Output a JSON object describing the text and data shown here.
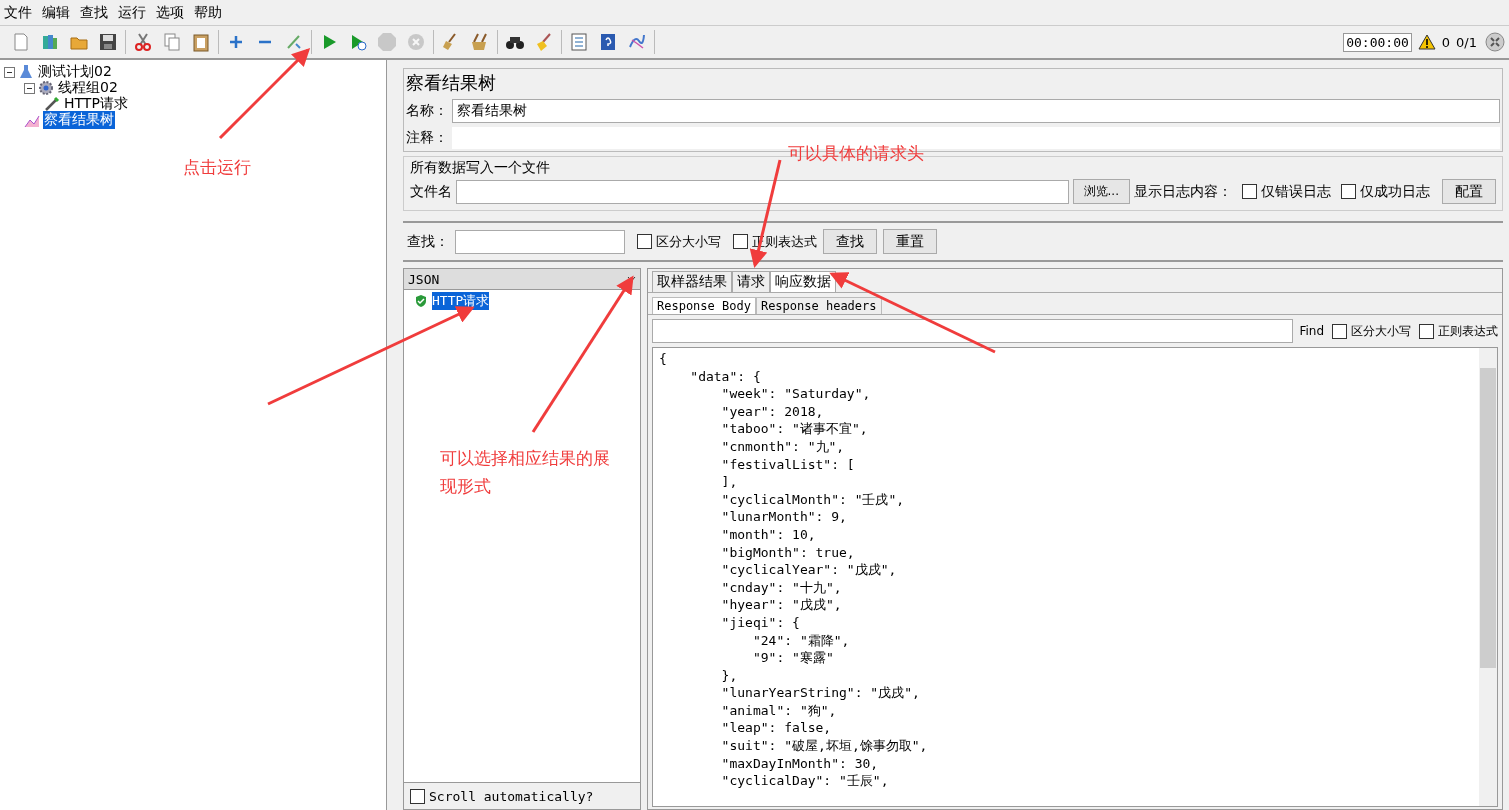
{
  "menu": [
    "文件",
    "编辑",
    "查找",
    "运行",
    "选项",
    "帮助"
  ],
  "toolbar": {
    "groups": [
      [
        {
          "kind": "new",
          "disabled": false
        },
        {
          "kind": "templates",
          "disabled": false
        },
        {
          "kind": "open",
          "disabled": false
        },
        {
          "kind": "save",
          "disabled": false
        }
      ],
      [
        {
          "kind": "cut",
          "disabled": false
        },
        {
          "kind": "copy",
          "disabled": false
        },
        {
          "kind": "paste",
          "disabled": false
        }
      ],
      [
        {
          "kind": "expand",
          "disabled": false
        },
        {
          "kind": "collapse",
          "disabled": false
        },
        {
          "kind": "toggle",
          "disabled": false
        }
      ],
      [
        {
          "kind": "start",
          "disabled": false
        },
        {
          "kind": "start-no-pause",
          "disabled": false
        },
        {
          "kind": "stop",
          "disabled": true
        },
        {
          "kind": "shutdown",
          "disabled": true
        }
      ],
      [
        {
          "kind": "clear",
          "disabled": false
        },
        {
          "kind": "clear-all",
          "disabled": false
        }
      ],
      [
        {
          "kind": "search",
          "disabled": false
        },
        {
          "kind": "reset-search",
          "disabled": false
        }
      ],
      [
        {
          "kind": "functions",
          "disabled": false
        },
        {
          "kind": "help",
          "disabled": false
        },
        {
          "kind": "logger",
          "disabled": false
        }
      ]
    ],
    "timer": "00:00:00",
    "warnings": "0",
    "threads": "0/1"
  },
  "tree": [
    {
      "label": "测试计划02",
      "kind": "plan",
      "expanded": true,
      "selected": false,
      "children": [
        {
          "label": "线程组02",
          "kind": "thread-group",
          "expanded": true,
          "selected": false,
          "children": [
            {
              "label": "HTTP请求",
              "kind": "sampler",
              "selected": false
            }
          ]
        },
        {
          "label": "察看结果树",
          "kind": "listener",
          "selected": true
        }
      ]
    }
  ],
  "panel": {
    "title": "察看结果树",
    "name_label": "名称：",
    "name_value": "察看结果树",
    "comment_label": "注释：",
    "file_group": {
      "legend": "所有数据写入一个文件",
      "file_label": "文件名",
      "browse": "浏览...",
      "log_label": "显示日志内容：",
      "options": [
        {
          "label": "仅错误日志",
          "checked": false
        },
        {
          "label": "仅成功日志",
          "checked": false
        }
      ],
      "configure": "配置"
    },
    "search": {
      "label": "查找：",
      "options": [
        {
          "label": "区分大小写",
          "checked": false
        },
        {
          "label": "正则表达式",
          "checked": false
        }
      ],
      "find": "查找",
      "reset": "重置"
    }
  },
  "results": {
    "renderer": "JSON",
    "items": [
      {
        "label": "HTTP请求",
        "success": true,
        "selected": true
      }
    ],
    "scroll": {
      "label": "Scroll automatically?",
      "checked": false
    },
    "tabs": [
      {
        "label": "取样器结果",
        "selected": false
      },
      {
        "label": "请求",
        "selected": false
      },
      {
        "label": "响应数据",
        "selected": true
      }
    ],
    "subtabs": [
      {
        "label": "Response Body",
        "selected": true
      },
      {
        "label": "Response headers",
        "selected": false
      }
    ],
    "find": {
      "label": "Find",
      "options": [
        {
          "label": "区分大小写",
          "checked": false
        },
        {
          "label": "正则表达式",
          "checked": false
        }
      ]
    },
    "body": [
      "{",
      "    \"data\": {",
      "        \"week\": \"Saturday\",",
      "        \"year\": 2018,",
      "        \"taboo\": \"诸事不宜\",",
      "        \"cnmonth\": \"九\",",
      "        \"festivalList\": [",
      "        ],",
      "        \"cyclicalMonth\": \"壬戌\",",
      "        \"lunarMonth\": 9,",
      "        \"month\": 10,",
      "        \"bigMonth\": true,",
      "        \"cyclicalYear\": \"戊戌\",",
      "        \"cnday\": \"十九\",",
      "        \"hyear\": \"戊戌\",",
      "        \"jieqi\": {",
      "            \"24\": \"霜降\",",
      "            \"9\": \"寒露\"",
      "        },",
      "        \"lunarYearString\": \"戊戌\",",
      "        \"animal\": \"狗\",",
      "        \"leap\": false,",
      "        \"suit\": \"破屋,坏垣,馀事勿取\",",
      "        \"maxDayInMonth\": 30,",
      "        \"cyclicalDay\": \"壬辰\","
    ]
  },
  "annotations": [
    "点击运行",
    "可以具体的请求头",
    "可以选择相应结果的展现形式"
  ]
}
